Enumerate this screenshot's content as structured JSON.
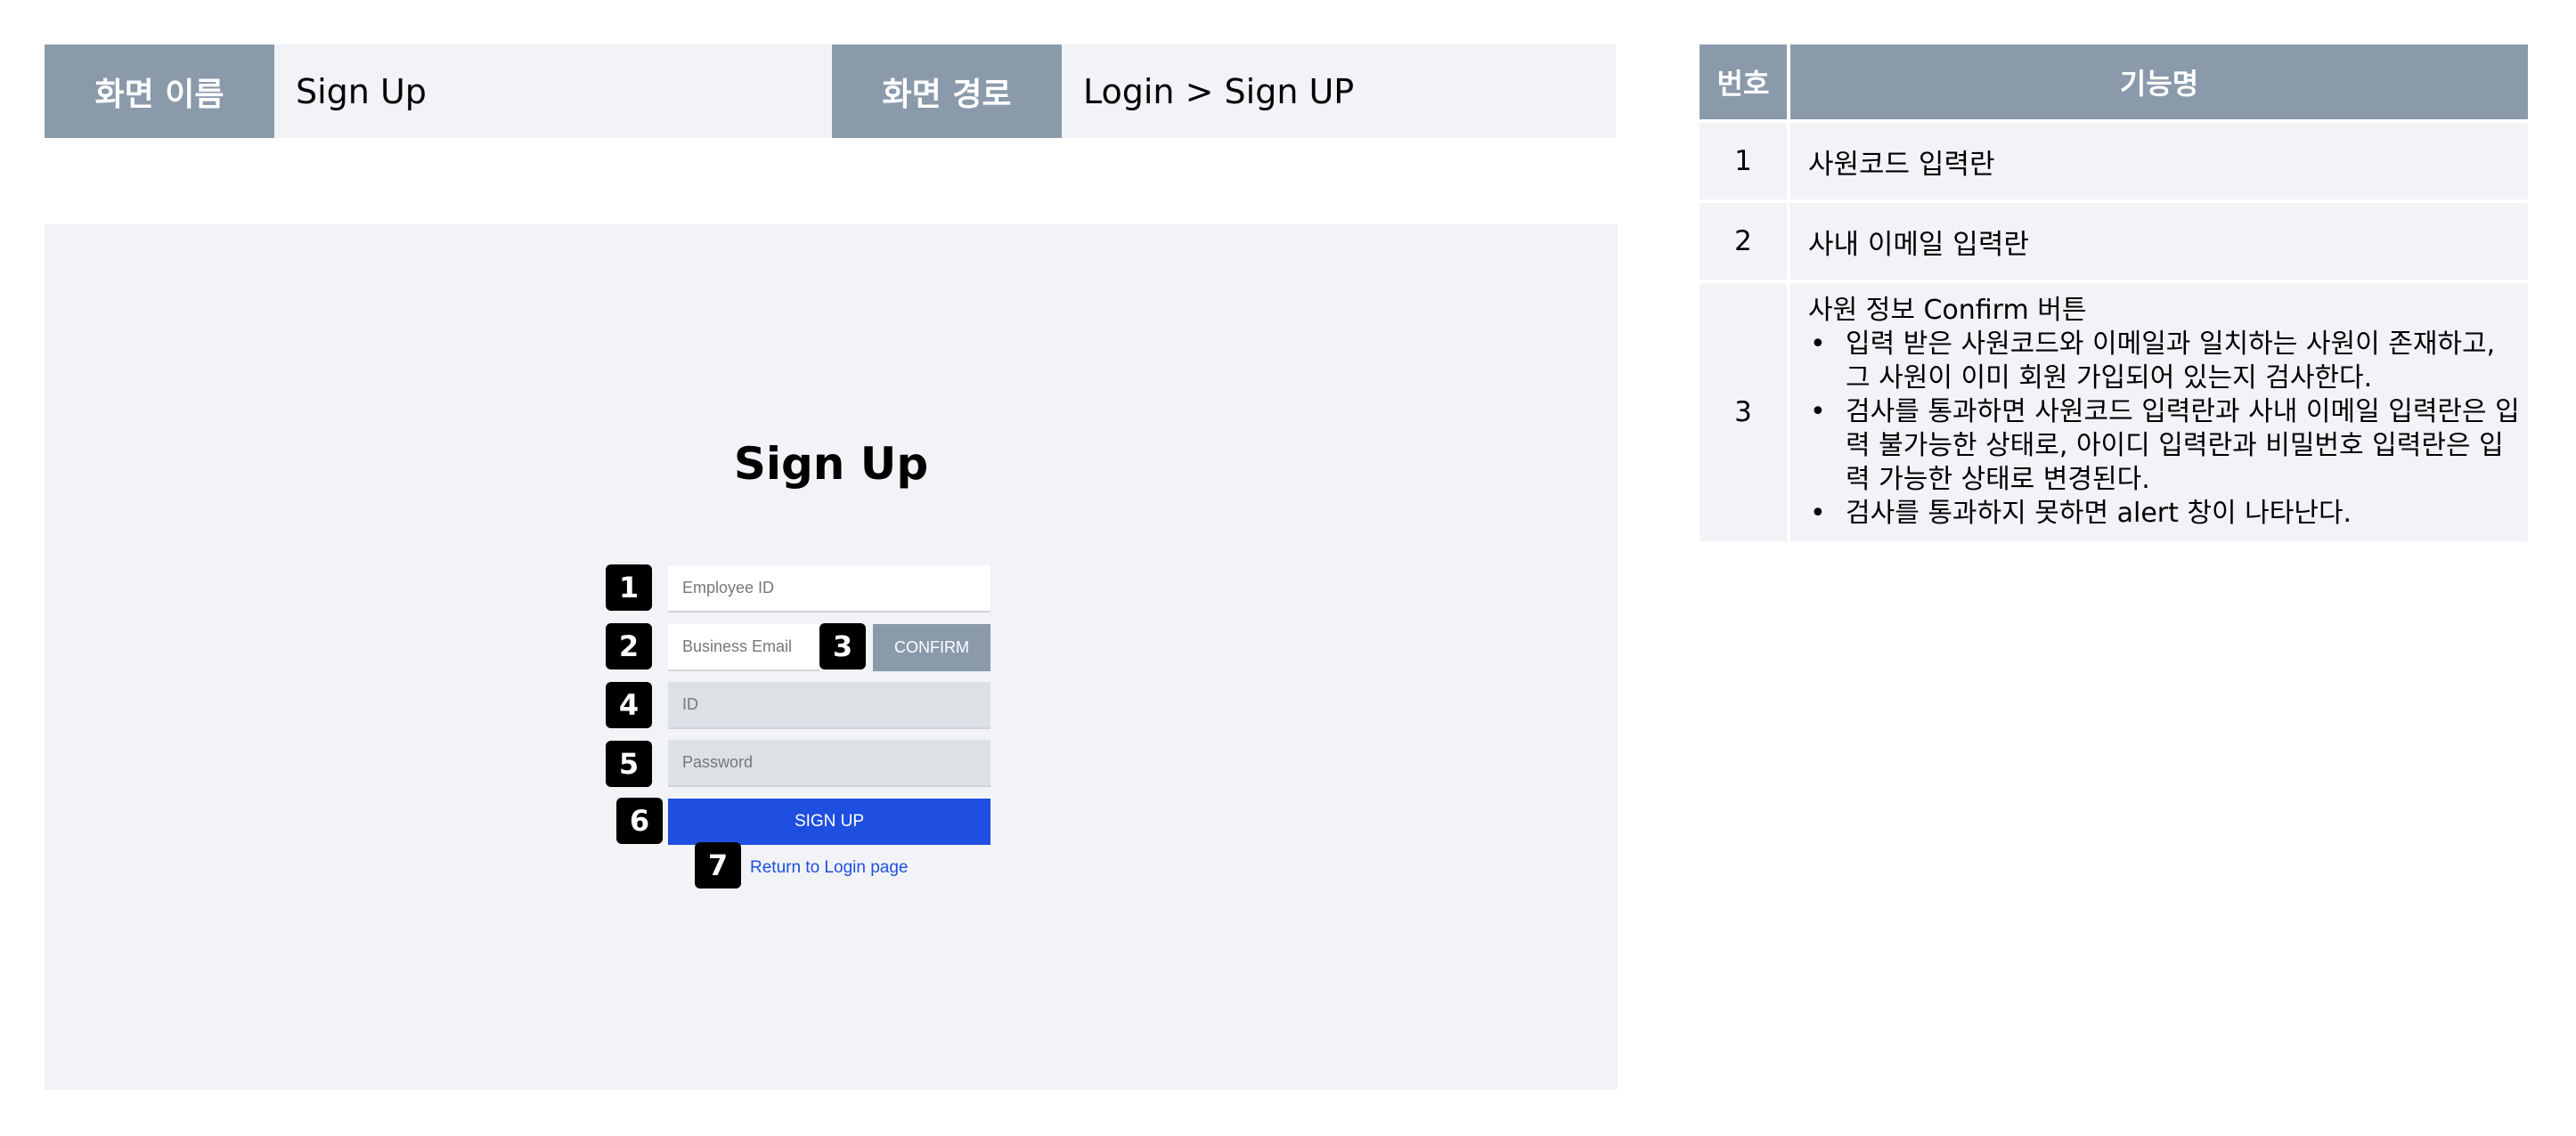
{
  "header": {
    "name_label": "화면 이름",
    "name_value": "Sign Up",
    "path_label": "화면 경로",
    "path_value": "Login > Sign UP"
  },
  "mockup": {
    "title": "Sign Up",
    "employee_id_placeholder": "Employee ID",
    "business_email_placeholder": "Business Email",
    "confirm_label": "CONFIRM",
    "id_placeholder": "ID",
    "password_placeholder": "Password",
    "signup_label": "SIGN UP",
    "return_link": "Return to Login page",
    "markers": [
      "1",
      "2",
      "3",
      "4",
      "5",
      "6",
      "7"
    ]
  },
  "table": {
    "col_no": "번호",
    "col_name": "기능명",
    "rows": [
      {
        "no": "1",
        "name": "사원코드 입력란"
      },
      {
        "no": "2",
        "name": "사내 이메일 입력란"
      },
      {
        "no": "3",
        "name": "사원 정보 Confirm 버튼",
        "bullets": [
          "입력 받은 사원코드와 이메일과 일치하는 사원이 존재하고, 그 사원이 이미 회원 가입되어 있는지 검사한다.",
          "검사를 통과하면 사원코드 입력란과 사내 이메일 입력란은 입력 불가능한 상태로,  아이디 입력란과 비밀번호 입력란은 입력 가능한 상태로 변경된다.",
          "검사를 통과하지 못하면 alert 창이 나타난다."
        ]
      }
    ]
  },
  "colors": {
    "header_bg": "#8a9aab",
    "panel_bg": "#f1f3f7",
    "primary": "#1f4fe0",
    "marker": "#000000"
  }
}
